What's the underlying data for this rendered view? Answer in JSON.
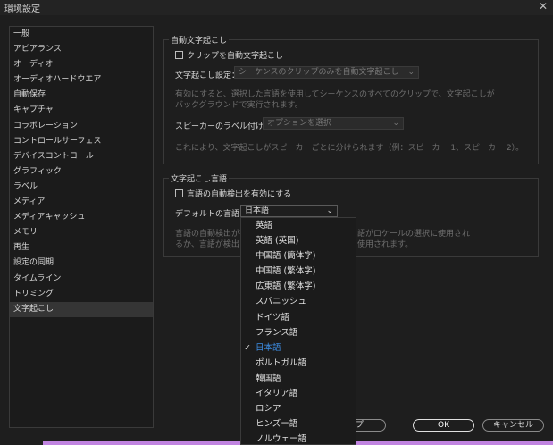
{
  "window": {
    "title": "環境設定",
    "close_glyph": "✕"
  },
  "sidebar": {
    "items": [
      {
        "label": "一般"
      },
      {
        "label": "アピアランス"
      },
      {
        "label": "オーディオ"
      },
      {
        "label": "オーディオハードウエア"
      },
      {
        "label": "自動保存"
      },
      {
        "label": "キャプチャ"
      },
      {
        "label": "コラボレーション"
      },
      {
        "label": "コントロールサーフェス"
      },
      {
        "label": "デバイスコントロール"
      },
      {
        "label": "グラフィック"
      },
      {
        "label": "ラベル"
      },
      {
        "label": "メディア"
      },
      {
        "label": "メディアキャッシュ"
      },
      {
        "label": "メモリ"
      },
      {
        "label": "再生"
      },
      {
        "label": "設定の同期"
      },
      {
        "label": "タイムライン"
      },
      {
        "label": "トリミング"
      },
      {
        "label": "文字起こし"
      }
    ],
    "selected": "文字起こし"
  },
  "auto_transcribe": {
    "group_title": "自動文字起こし",
    "checkbox_label": "クリップを自動文字起こし",
    "checked": false,
    "setting_label": "文字起こし設定：",
    "setting_value": "シーケンスのクリップのみを自動文字起こし",
    "description": "有効にすると、選択した言語を使用してシーケンスのすべてのクリップで、文字起こしが",
    "description2": "バックグラウンドで実行されます。",
    "speaker_label": "スピーカーのラベル付け：",
    "speaker_value": "オプションを選択",
    "speaker_description": "これにより、文字起こしがスピーカーごとに分けられます（例：スピーカー 1、スピーカー 2）。"
  },
  "language": {
    "group_title": "文字起こし言語",
    "checkbox_label": "言語の自動検出を有効にする",
    "checked": false,
    "default_label": "デフォルトの言語：",
    "default_value": "日本語",
    "desc_line1_left": "言語の自動検出が有",
    "desc_line1_right": "語がロケールの選択に使用され",
    "desc_line2_left": "るか、言語が検出さ",
    "desc_line2_right": "使用されます。"
  },
  "dropdown_options": [
    {
      "label": "英語"
    },
    {
      "label": "英語 (英国)"
    },
    {
      "label": "中国語 (簡体字)"
    },
    {
      "label": "中国語 (繁体字)"
    },
    {
      "label": "広東語 (繁体字)"
    },
    {
      "label": "スパニッシュ"
    },
    {
      "label": "ドイツ語"
    },
    {
      "label": "フランス語"
    },
    {
      "label": "日本語"
    },
    {
      "label": "ポルトガル語"
    },
    {
      "label": "韓国語"
    },
    {
      "label": "イタリア語"
    },
    {
      "label": "ロシア"
    },
    {
      "label": "ヒンズー語"
    },
    {
      "label": "ノルウェー語"
    }
  ],
  "dropdown_selected": "日本語",
  "buttons": {
    "help_partial": "プ",
    "ok": "OK",
    "cancel": "キャンセル"
  },
  "colors": {
    "accent": "#3d8ee5",
    "bottom_bar": "#c084e0"
  }
}
